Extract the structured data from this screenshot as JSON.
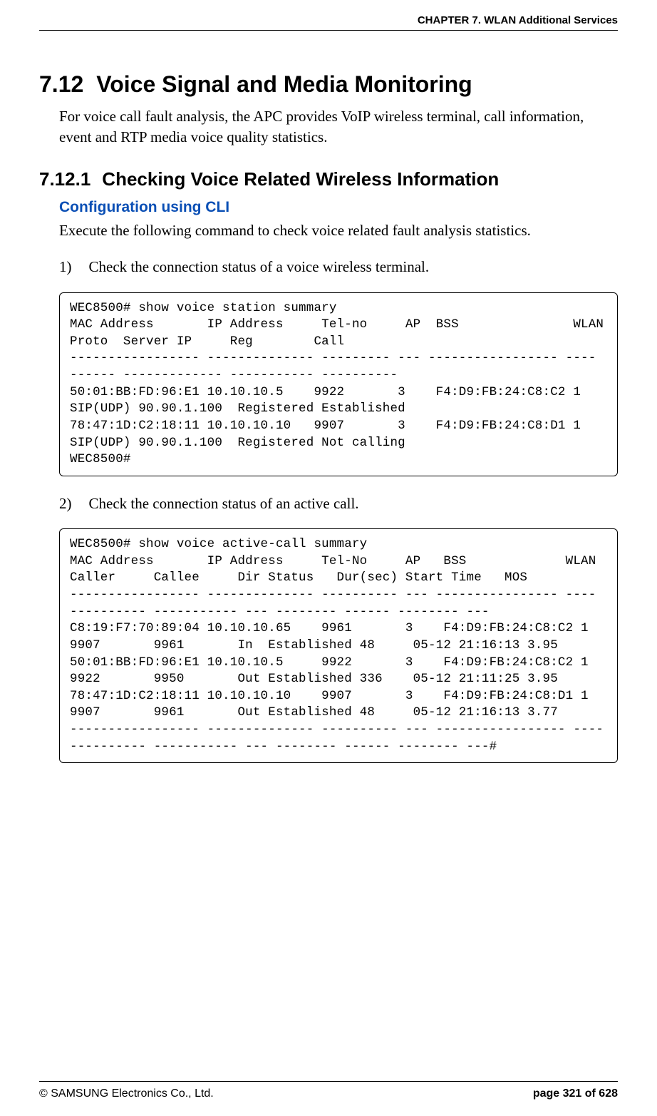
{
  "header": {
    "chapter": "CHAPTER 7. WLAN Additional Services"
  },
  "section": {
    "number": "7.12",
    "title": "Voice Signal and Media Monitoring",
    "intro": "For voice call fault analysis, the APC provides VoIP wireless terminal, call information, event and RTP media voice quality statistics."
  },
  "subsection": {
    "number": "7.12.1",
    "title": "Checking Voice Related Wireless Information",
    "config_heading": "Configuration using CLI",
    "instruction": "Execute the following command to check voice related fault analysis statistics.",
    "steps": {
      "1": {
        "num": "1)",
        "text": "Check the connection status of a voice wireless terminal.",
        "code": "WEC8500# show voice station summary\nMAC Address       IP Address     Tel-no     AP  BSS               WLAN\nProto  Server IP     Reg        Call\n----------------- -------------- --------- --- ----------------- ----\n------ ------------- ----------- ----------\n50:01:BB:FD:96:E1 10.10.10.5    9922       3    F4:D9:FB:24:C8:C2 1\nSIP(UDP) 90.90.1.100  Registered Established\n78:47:1D:C2:18:11 10.10.10.10   9907       3    F4:D9:FB:24:C8:D1 1\nSIP(UDP) 90.90.1.100  Registered Not calling\nWEC8500#"
      },
      "2": {
        "num": "2)",
        "text": "Check the connection status of an active call.",
        "code": "WEC8500# show voice active-call summary\nMAC Address       IP Address     Tel-No     AP   BSS             WLAN\nCaller     Callee     Dir Status   Dur(sec) Start Time   MOS\n----------------- -------------- ---------- --- ---------------- ----\n---------- ----------- --- -------- ------ -------- ---\nC8:19:F7:70:89:04 10.10.10.65    9961       3    F4:D9:FB:24:C8:C2 1\n9907       9961       In  Established 48     05-12 21:16:13 3.95\n50:01:BB:FD:96:E1 10.10.10.5     9922       3    F4:D9:FB:24:C8:C2 1\n9922       9950       Out Established 336    05-12 21:11:25 3.95\n78:47:1D:C2:18:11 10.10.10.10    9907       3    F4:D9:FB:24:C8:D1 1\n9907       9961       Out Established 48     05-12 21:16:13 3.77\n----------------- -------------- ---------- --- ----------------- ----\n---------- ----------- --- -------- ------ -------- ---#"
      }
    }
  },
  "footer": {
    "left": "© SAMSUNG Electronics Co., Ltd.",
    "right": "page 321 of 628"
  }
}
